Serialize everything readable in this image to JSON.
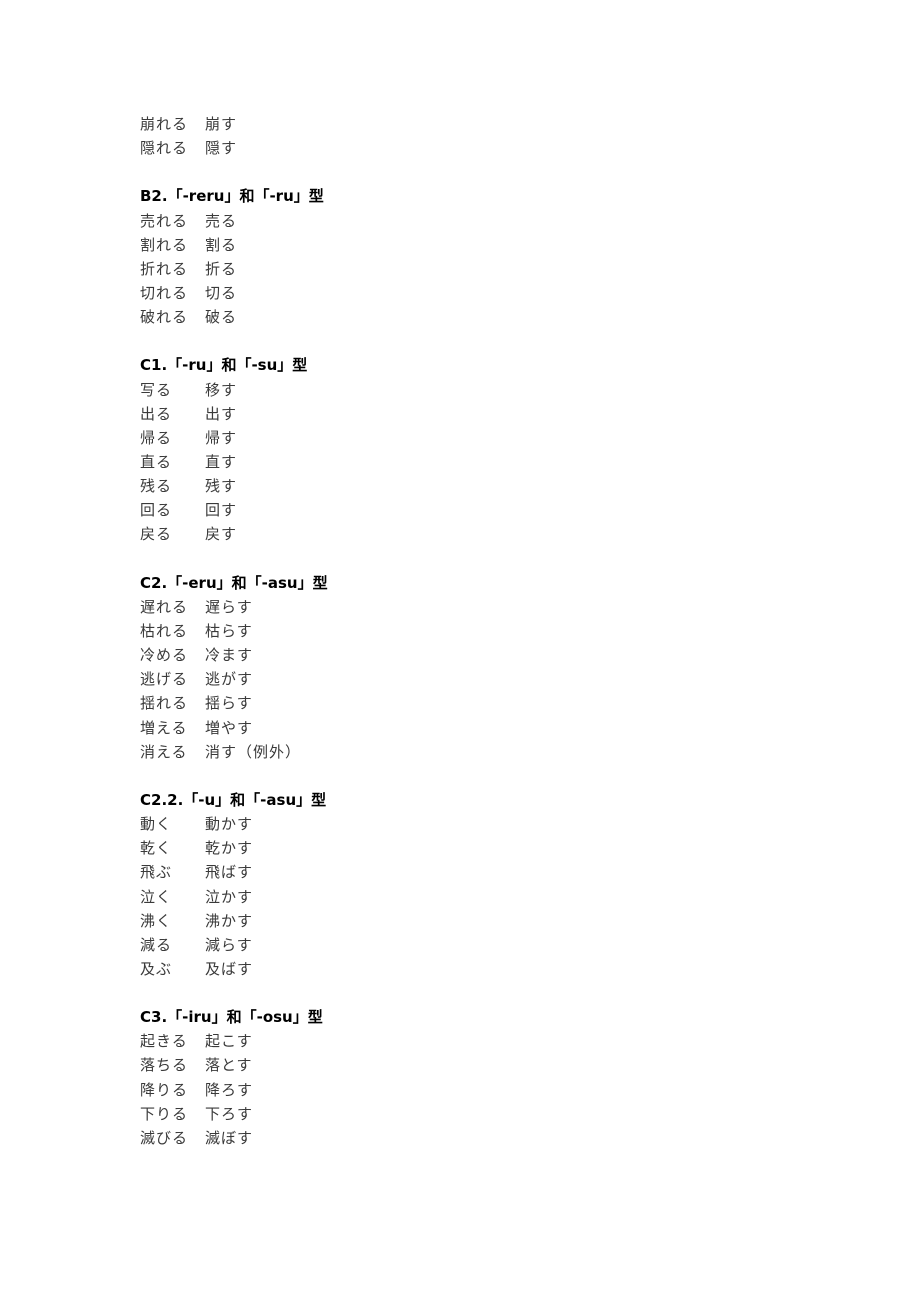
{
  "sections": [
    {
      "heading": "",
      "rows": [
        [
          "崩れる",
          "崩す"
        ],
        [
          "隠れる",
          "隠す"
        ]
      ]
    },
    {
      "heading": "B2.「-reru」和「-ru」型",
      "rows": [
        [
          "売れる",
          "売る"
        ],
        [
          "割れる",
          "割る"
        ],
        [
          "折れる",
          "折る"
        ],
        [
          "切れる",
          "切る"
        ],
        [
          "破れる",
          "破る"
        ]
      ]
    },
    {
      "heading": "C1.「-ru」和「-su」型",
      "rows": [
        [
          "写る",
          "移す"
        ],
        [
          "出る",
          "出す"
        ],
        [
          "帰る",
          "帰す"
        ],
        [
          "直る",
          "直す"
        ],
        [
          "残る",
          "残す"
        ],
        [
          "回る",
          "回す"
        ],
        [
          "戻る",
          "戻す"
        ]
      ]
    },
    {
      "heading": "C2.「-eru」和「-asu」型",
      "rows": [
        [
          "遅れる",
          "遅らす"
        ],
        [
          "枯れる",
          "枯らす"
        ],
        [
          "冷める",
          "冷ます"
        ],
        [
          "逃げる",
          "逃がす"
        ],
        [
          "揺れる",
          "揺らす"
        ],
        [
          "増える",
          "増やす"
        ],
        [
          "消える",
          "消す（例外）"
        ]
      ]
    },
    {
      "heading": "C2.2.「-u」和「-asu」型",
      "rows": [
        [
          "動く",
          "動かす"
        ],
        [
          "乾く",
          "乾かす"
        ],
        [
          "飛ぶ",
          "飛ばす"
        ],
        [
          "泣く",
          "泣かす"
        ],
        [
          "沸く",
          "沸かす"
        ],
        [
          "減る",
          "減らす"
        ],
        [
          "及ぶ",
          "及ばす"
        ]
      ]
    },
    {
      "heading": "C3.「-iru」和「-osu」型",
      "rows": [
        [
          "起きる",
          "起こす"
        ],
        [
          "落ちる",
          "落とす"
        ],
        [
          "降りる",
          "降ろす"
        ],
        [
          "下りる",
          "下ろす"
        ],
        [
          "滅びる",
          "滅ぼす"
        ]
      ]
    }
  ]
}
